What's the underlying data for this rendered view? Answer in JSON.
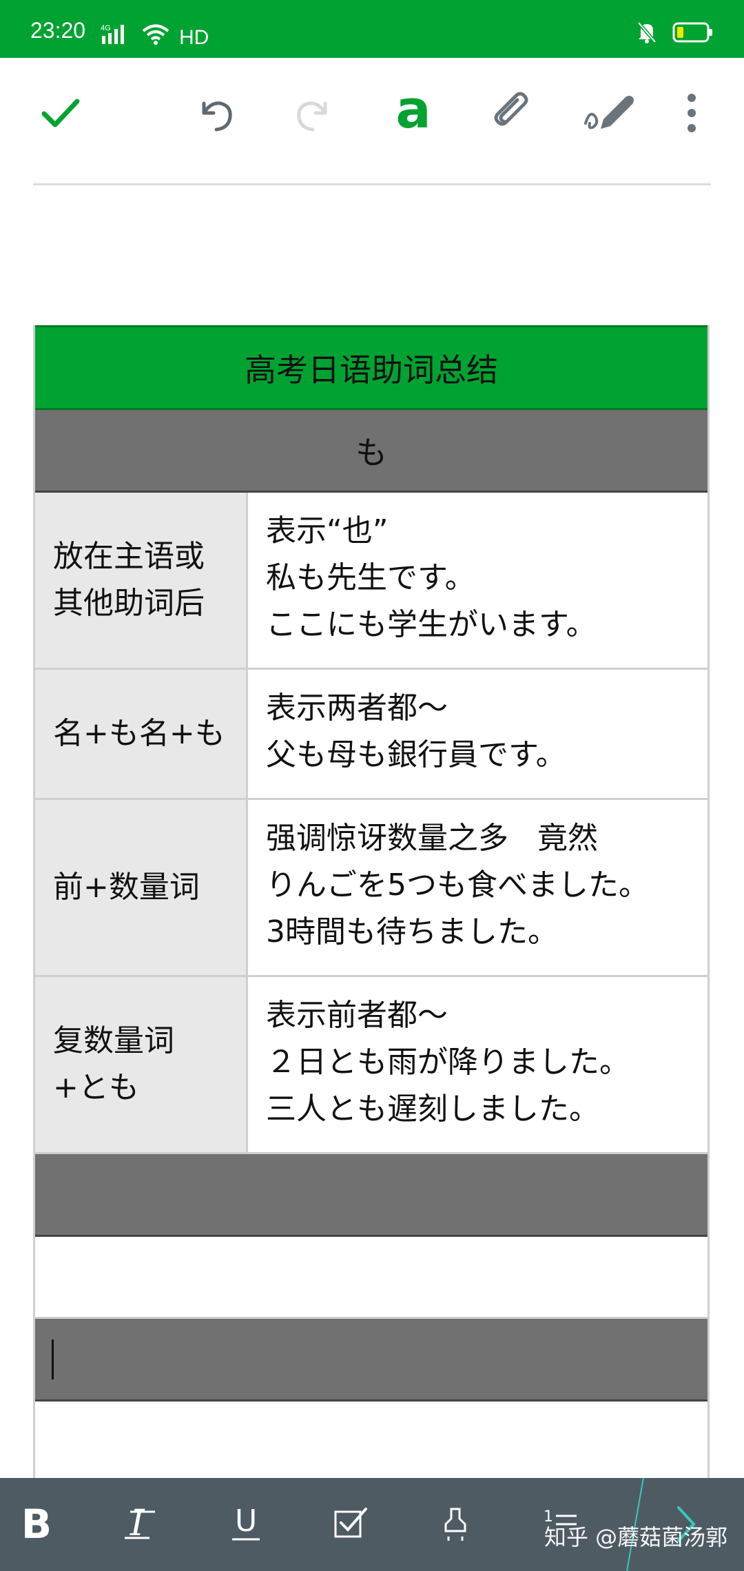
{
  "status_bar": {
    "time": "23:20",
    "network": "4G",
    "hd_label": "HD"
  },
  "toolbar": {
    "font_label": "a"
  },
  "table": {
    "title": "高考日语助词总结",
    "subtitle": "も",
    "rows": [
      {
        "left": [
          "放在主语或",
          "其他助词后"
        ],
        "right": [
          "表示“也”",
          "私も先生です。",
          "ここにも学生がいます。"
        ]
      },
      {
        "left": [
          "名+も名+も"
        ],
        "right": [
          "表示两者都～",
          "父も母も銀行員です。"
        ]
      },
      {
        "left": [
          "前+数量词"
        ],
        "right": [
          "强调惊讶数量之多   竟然",
          "りんごを5つも食べました。",
          "3時間も待ちました。"
        ]
      },
      {
        "left": [
          "复数量词",
          "+とも"
        ],
        "right": [
          "表示前者都～",
          "２日とも雨が降りました。",
          "三人とも遅刻しました。"
        ]
      }
    ]
  },
  "format_bar": {
    "bold_label": "B",
    "italic_label": "I",
    "underline_label": "U",
    "list_label": "1"
  },
  "watermark": "知乎 @蘑菇菌汤郭",
  "colors": {
    "accent": "#00a331",
    "header_gray": "#717171",
    "label_bg": "#e8e8e8",
    "format_bar": "#4f5b63"
  }
}
